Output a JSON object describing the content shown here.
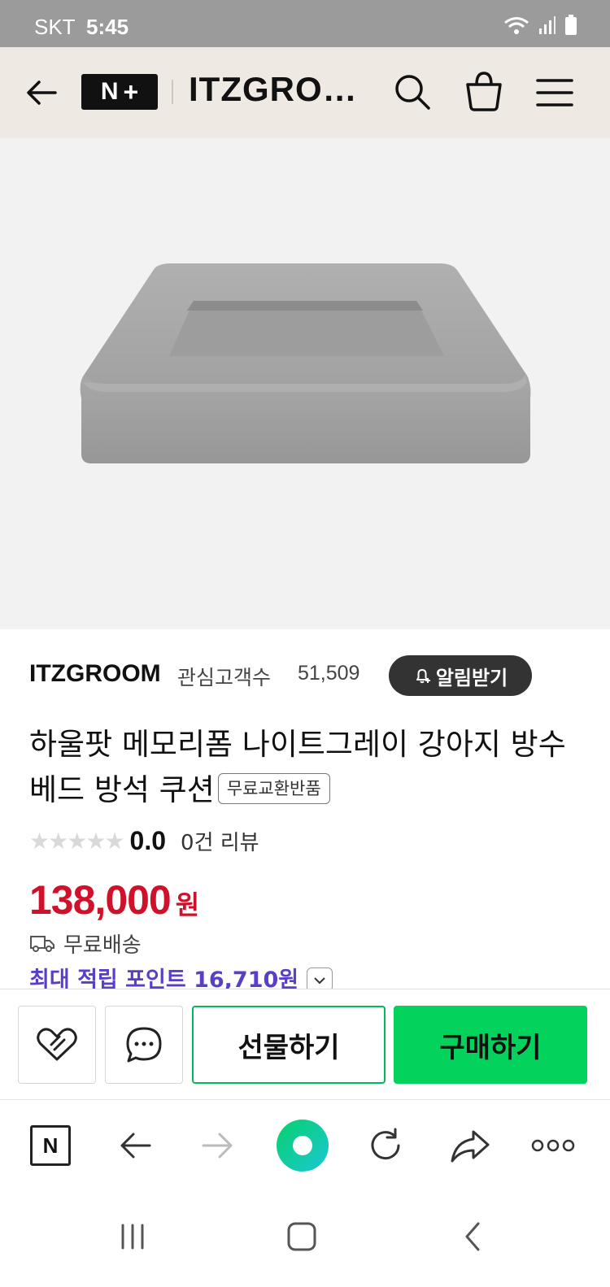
{
  "status_bar": {
    "carrier": "SKT",
    "time": "5:45",
    "icons": [
      "wifi-icon",
      "signal-icon",
      "battery-icon"
    ]
  },
  "header": {
    "logo_letter": "N",
    "logo_symbol": "+",
    "title": "ITZGRO…",
    "icons": [
      "back-arrow-icon",
      "search-icon",
      "shopping-bag-icon",
      "hamburger-menu-icon"
    ]
  },
  "product": {
    "store_name": "ITZGROOM",
    "fan_label": "관심고객수",
    "fan_count": "51,509",
    "notify_label": "알림받기",
    "title": "하울팟 메모리폼 나이트그레이 강아지 방수 베드 방석 쿠션",
    "badge": "무료교환반품",
    "rating_score": "0.0",
    "stars_filled": 0,
    "stars_total": 5,
    "review_count": "0건 리뷰",
    "price": "138,000",
    "price_unit": "원",
    "shipping": "무료배송",
    "points": "최대 적립 포인트 16,710원"
  },
  "actions": {
    "gift_label": "선물하기",
    "buy_label": "구매하기",
    "icons": [
      "heart-icon",
      "chat-bubble-icon"
    ]
  },
  "browser_toolbar": {
    "home_letter": "N",
    "icons": [
      "naver-home-icon",
      "back-icon",
      "forward-icon",
      "green-circle-icon",
      "refresh-icon",
      "share-icon",
      "more-icon"
    ]
  },
  "system_nav": {
    "icons": [
      "recent-apps-icon",
      "home-button-icon",
      "system-back-icon"
    ]
  },
  "colors": {
    "price_red": "#d0112b",
    "points_purple": "#5a3ec8",
    "buy_green": "#03d25c",
    "header_bg": "#efe9e4",
    "status_bar_bg": "#9b9b9b"
  }
}
